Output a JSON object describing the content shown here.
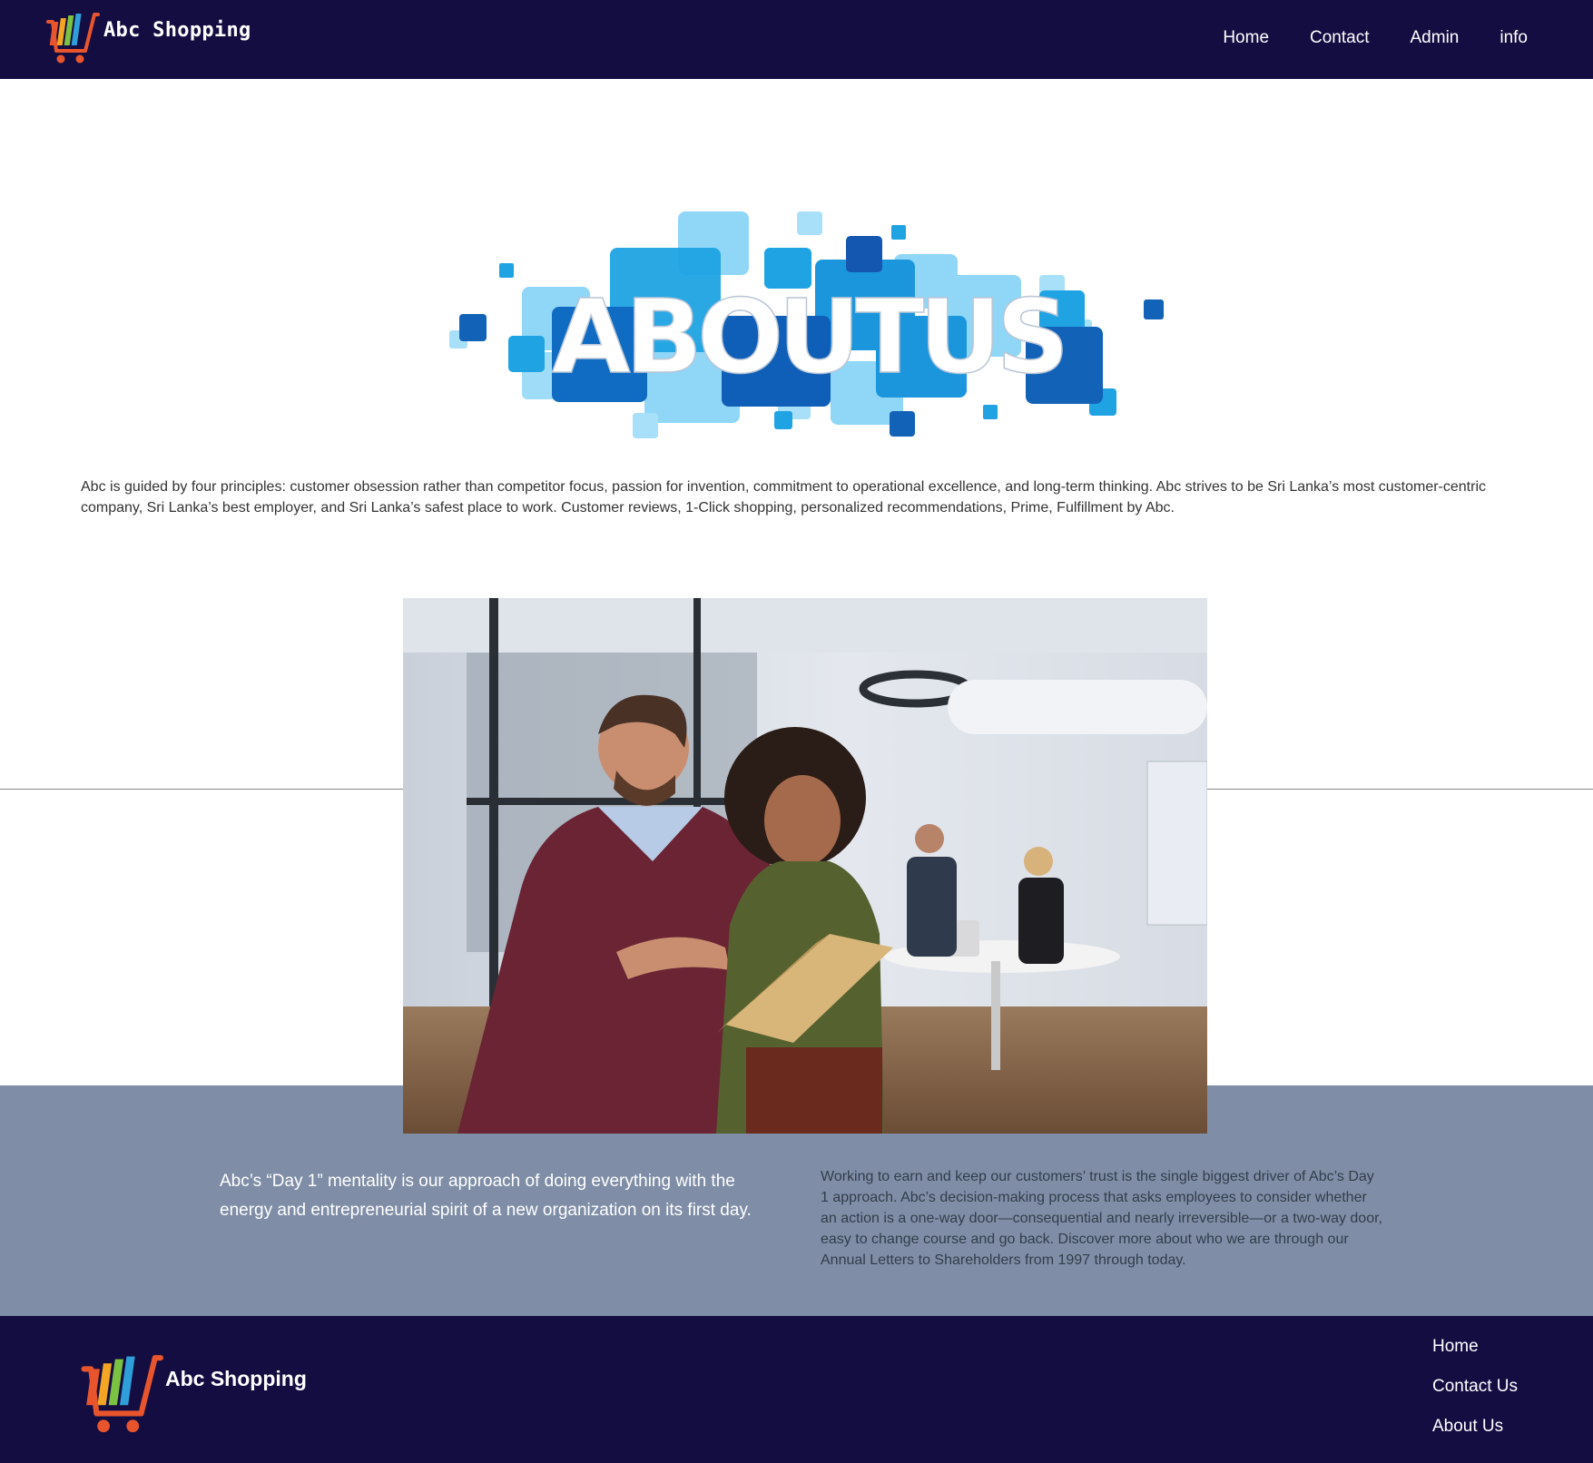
{
  "header": {
    "brand_name": "Abc Shopping",
    "nav": [
      {
        "label": "Home"
      },
      {
        "label": "Contact"
      },
      {
        "label": "Admin"
      },
      {
        "label": "info"
      }
    ]
  },
  "about": {
    "banner_text": "ABOUTUS",
    "intro": "Abc is guided by four principles: customer obsession rather than competitor focus, passion for invention, commitment to operational excellence, and long-term thinking. Abc strives to be Sri Lanka’s most customer-centric company, Sri Lanka’s best employer, and Sri Lanka’s safest place to work. Customer reviews, 1-Click shopping, personalized recommendations, Prime, Fulfillment by Abc."
  },
  "mission": {
    "left_text": "Abc’s “Day 1” mentality is our approach of doing everything with the energy and entrepreneurial spirit of a new organization on its first day.",
    "right_text": "Working to earn and keep our customers’ trust is the single biggest driver of Abc’s Day 1 approach. Abc’s decision-making process that asks employees to consider whether an action is a one-way door—consequential and nearly irreversible—or a two-way door, easy to change course and go back. Discover more about who we are through our Annual Letters to Shareholders from 1997 through today."
  },
  "footer": {
    "brand_name": "Abc Shopping",
    "links": [
      {
        "label": "Home"
      },
      {
        "label": "Contact Us"
      },
      {
        "label": "About Us"
      }
    ]
  },
  "colors": {
    "navy": "#140d42",
    "band": "#7f8ea6",
    "accent_blue": "#1a8ed8"
  }
}
